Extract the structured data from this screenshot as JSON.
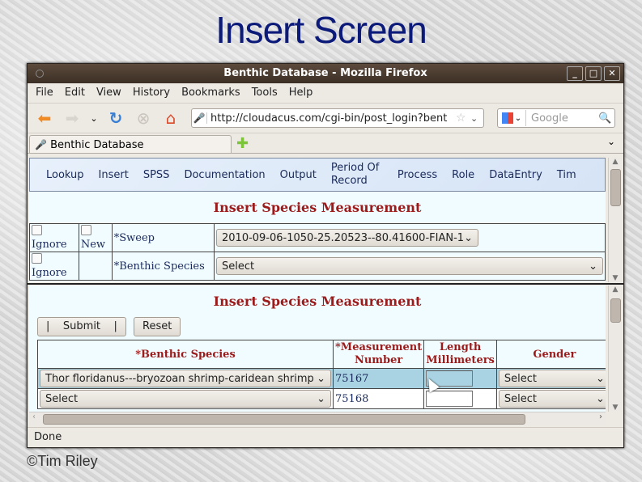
{
  "slide": {
    "title": "Insert Screen",
    "copyright": "©Tim Riley"
  },
  "window": {
    "title": "Benthic Database - Mozilla Firefox",
    "buttons": {
      "minimize": "_",
      "maximize": "□",
      "close": "✕"
    }
  },
  "menubar": [
    "File",
    "Edit",
    "View",
    "History",
    "Bookmarks",
    "Tools",
    "Help"
  ],
  "toolbar": {
    "url": "http://cloudacus.com/cgi-bin/post_login?bent",
    "search_placeholder": "Google"
  },
  "tabs": [
    {
      "label": "Benthic Database"
    }
  ],
  "nav": {
    "items": [
      "Lookup",
      "Insert",
      "SPSS",
      "Documentation",
      "Output",
      "Period Of Record",
      "Process",
      "Role",
      "DataEntry",
      "Tim"
    ]
  },
  "top_form": {
    "title": "Insert Species Measurement",
    "rows": [
      {
        "checks": [
          "Ignore",
          "New"
        ],
        "label": "*Sweep",
        "value": "2010-09-06-1050-25.20523--80.41600-FIAN-1"
      },
      {
        "checks": [
          "Ignore"
        ],
        "label": "*Benthic Species",
        "value": "Select"
      }
    ]
  },
  "bottom_form": {
    "title": "Insert Species Measurement",
    "submit_label": "|    Submit    |",
    "reset_label": "Reset",
    "columns": [
      "*Benthic Species",
      "*Measurement Number",
      "Length Millimeters",
      "Gender"
    ],
    "rows": [
      {
        "species": "Thor floridanus---bryozoan shrimp-caridean shrimp",
        "number": "75167",
        "length": "",
        "gender": "Select",
        "highlighted": true
      },
      {
        "species": "Select",
        "number": "75168",
        "length": "",
        "gender": "Select",
        "highlighted": false
      }
    ]
  },
  "status": "Done",
  "colors": {
    "title_blue": "#0c1a7a",
    "heading_red": "#9c1a1a",
    "row_highlight": "#a9d3e3"
  }
}
